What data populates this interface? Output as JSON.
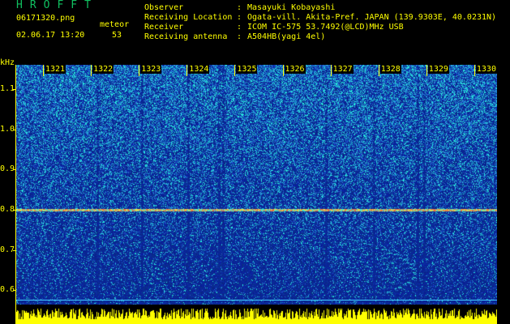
{
  "header": {
    "logo": "HROFFT",
    "filename": "06171320.png",
    "meteor_label": "meteor",
    "datetime": "02.06.17 13:20",
    "meteor_count": "53"
  },
  "station_info": [
    {
      "key": "Observer",
      "value": "Masayuki Kobayashi"
    },
    {
      "key": "Receiving Location",
      "value": "Ogata-vill. Akita-Pref. JAPAN (139.9303E, 40.0231N)"
    },
    {
      "key": "Receiver",
      "value": "ICOM IC-575 53.7492(@LCD)MHz USB"
    },
    {
      "key": "Receiving antenna",
      "value": "A504HB(yagi 4el)"
    }
  ],
  "spectrogram": {
    "y_unit": "kHz",
    "y_ticks": [
      "1.1",
      "1.0",
      "0.9",
      "0.8",
      "0.7",
      "0.6"
    ],
    "time_labels": [
      "1321",
      "1322",
      "1323",
      "1324",
      "1325",
      "1326",
      "1327",
      "1328",
      "1329",
      "1330"
    ],
    "carrier_khz": 0.8,
    "colors": {
      "background": "#0a1c8c",
      "noise_high": "#18c8e0",
      "noise_low": "#1830c8",
      "carrier": "#e06040",
      "activity": "#ffff00",
      "baseline": "#40c8ff",
      "text": "#ffff00",
      "logo": "#10c060"
    }
  }
}
